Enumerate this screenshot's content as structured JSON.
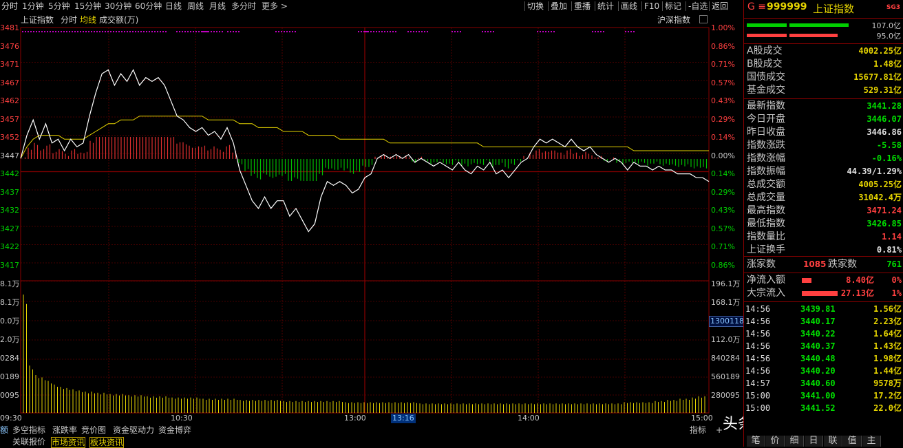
{
  "toolbar": {
    "periods": [
      "分时",
      "1分钟",
      "5分钟",
      "15分钟",
      "30分钟",
      "60分钟",
      "日线",
      "周线",
      "月线",
      "多分时",
      "更多 >"
    ],
    "tools": [
      "切换",
      "叠加",
      "重播",
      "统计",
      "画线",
      "F10",
      "标记",
      "-自选",
      "返回"
    ]
  },
  "chart_header": {
    "name": "上证指数",
    "mode": "分时",
    "avg": "均线",
    "vol_label": "成交额(万)",
    "market": "沪深指数"
  },
  "price_axis": [
    "3481",
    "3476",
    "3471",
    "3467",
    "3462",
    "3457",
    "3452",
    "3447",
    "3442",
    "3437",
    "3432",
    "3427",
    "3422",
    "3417"
  ],
  "pct_axis": [
    "1.00%",
    "0.86%",
    "0.71%",
    "0.57%",
    "0.43%",
    "0.29%",
    "0.14%",
    "0.00%",
    "0.14%",
    "0.29%",
    "0.43%",
    "0.57%",
    "0.71%",
    "0.86%"
  ],
  "vol_axis_left": [
    "8.1万",
    "8.1万",
    "0.0万",
    "2.0万",
    "0284",
    "0189",
    "0095"
  ],
  "vol_axis_right": [
    "196.1万",
    "168.1万",
    "1300118",
    "112.0万",
    "840284",
    "560189",
    "280095"
  ],
  "time_axis": [
    "09:30",
    "10:30",
    "13:00",
    "13:16",
    "14:00",
    "15:00"
  ],
  "chart_data": {
    "type": "line",
    "title": "上证指数 分时",
    "prev_close": 3446.86,
    "ylim": [
      3417,
      3481
    ],
    "x_label": "time",
    "series": [
      {
        "name": "指数",
        "color": "#ffffff",
        "values": [
          3447,
          3453,
          3457,
          3452,
          3456,
          3451,
          3452,
          3449,
          3452,
          3450,
          3451,
          3458,
          3464,
          3469,
          3470,
          3466,
          3469,
          3467,
          3470,
          3466,
          3468,
          3467,
          3468,
          3466,
          3462,
          3458,
          3457,
          3455,
          3454,
          3455,
          3453,
          3454,
          3452,
          3455,
          3451,
          3444,
          3440,
          3436,
          3434,
          3437,
          3434,
          3436,
          3436,
          3432,
          3434,
          3431,
          3428,
          3430,
          3437,
          3441,
          3440,
          3441,
          3440,
          3438,
          3439,
          3442,
          3443,
          3447,
          3448,
          3447,
          3448,
          3447,
          3448,
          3446,
          3447,
          3446,
          3445,
          3446,
          3445,
          3444,
          3446,
          3444,
          3443,
          3445,
          3444,
          3446,
          3443,
          3444,
          3442,
          3444,
          3446,
          3447,
          3450,
          3452,
          3451,
          3452,
          3451,
          3450,
          3452,
          3450,
          3449,
          3450,
          3448,
          3447,
          3446,
          3447,
          3446,
          3444,
          3446,
          3445,
          3445,
          3444,
          3445,
          3444,
          3444,
          3443,
          3443,
          3443,
          3442,
          3442,
          3441
        ]
      },
      {
        "name": "均线",
        "color": "#e6d400",
        "values": [
          3447,
          3450,
          3452,
          3453,
          3453,
          3453,
          3453,
          3452,
          3452,
          3452,
          3452,
          3453,
          3454,
          3455,
          3456,
          3456,
          3457,
          3457,
          3457,
          3458,
          3458,
          3458,
          3458,
          3458,
          3458,
          3458,
          3458,
          3458,
          3458,
          3458,
          3457,
          3457,
          3457,
          3457,
          3457,
          3456,
          3456,
          3456,
          3455,
          3455,
          3455,
          3455,
          3454,
          3454,
          3454,
          3454,
          3453,
          3453,
          3453,
          3453,
          3453,
          3452,
          3452,
          3452,
          3452,
          3452,
          3452,
          3452,
          3452,
          3451,
          3451,
          3451,
          3451,
          3451,
          3451,
          3451,
          3451,
          3451,
          3451,
          3451,
          3451,
          3451,
          3451,
          3451,
          3450,
          3450,
          3450,
          3450,
          3450,
          3450,
          3450,
          3450,
          3450,
          3450,
          3450,
          3450,
          3450,
          3450,
          3450,
          3450,
          3450,
          3450,
          3450,
          3450,
          3450,
          3450,
          3450,
          3450,
          3449,
          3449,
          3449,
          3449,
          3449,
          3449,
          3449,
          3449,
          3449,
          3449,
          3449,
          3449,
          3449
        ]
      }
    ],
    "volume": [
      100,
      40,
      32,
      30,
      27,
      24,
      22,
      21,
      20,
      19,
      18,
      18,
      17,
      17,
      16,
      16,
      16,
      15,
      15,
      15,
      14,
      14,
      14,
      14,
      13,
      13,
      13,
      13,
      13,
      12,
      12,
      12,
      12,
      12,
      12,
      11,
      11,
      11,
      11,
      11,
      11,
      11,
      10,
      10,
      10,
      10,
      10,
      10,
      10,
      10,
      10,
      10,
      9,
      9,
      9,
      9,
      9,
      9,
      9,
      9,
      9,
      9,
      9,
      9,
      8,
      8,
      8,
      8,
      8,
      8,
      8,
      8,
      8,
      8,
      8,
      8,
      8,
      8,
      8,
      8,
      8,
      8,
      8,
      8,
      8,
      8,
      8,
      8,
      8,
      8,
      8,
      8,
      8,
      8,
      8,
      8,
      8,
      9,
      9,
      9,
      9,
      9,
      10,
      10,
      11,
      11,
      12,
      12,
      13,
      14,
      14
    ]
  },
  "right_panel": {
    "code_prefix": "G ≡",
    "code": "999999",
    "name": "上证指数",
    "badge": "SG3",
    "bar1": "107.0亿",
    "bar2": "95.0亿",
    "turnover": [
      {
        "k": "A股成交",
        "v": "4002.25亿"
      },
      {
        "k": "B股成交",
        "v": "1.48亿"
      },
      {
        "k": "国债成交",
        "v": "15677.81亿"
      },
      {
        "k": "基金成交",
        "v": "529.31亿"
      }
    ],
    "stats": [
      {
        "k": "最新指数",
        "v": "3441.28",
        "c": "#00e000"
      },
      {
        "k": "今日开盘",
        "v": "3446.07",
        "c": "#00e000"
      },
      {
        "k": "昨日收盘",
        "v": "3446.86",
        "c": "#e0e0e0"
      },
      {
        "k": "指数涨跌",
        "v": "-5.58",
        "c": "#00e000"
      },
      {
        "k": "指数涨幅",
        "v": "-0.16%",
        "c": "#00e000"
      },
      {
        "k": "指数振幅",
        "v": "44.39/1.29%",
        "c": "#e0e0e0"
      },
      {
        "k": "总成交额",
        "v": "4005.25亿",
        "c": "#e6d400"
      },
      {
        "k": "总成交量",
        "v": "31042.4万",
        "c": "#e6d400"
      },
      {
        "k": "最高指数",
        "v": "3471.24",
        "c": "#ff4040"
      },
      {
        "k": "最低指数",
        "v": "3426.85",
        "c": "#00e000"
      },
      {
        "k": "指数量比",
        "v": "1.14",
        "c": "#ff4040"
      },
      {
        "k": "上证换手",
        "v": "0.81%",
        "c": "#e0e0e0"
      }
    ],
    "up_label": "涨家数",
    "up_count": "1085",
    "down_label": "跌家数",
    "down_count": "761",
    "flows": [
      {
        "k": "净流入额",
        "v": "8.40亿",
        "p": "0%"
      },
      {
        "k": "大宗流入",
        "v": "27.13亿",
        "p": "1%"
      }
    ],
    "ticks": [
      {
        "t": "14:56",
        "p": "3439.81",
        "a": "1.56亿"
      },
      {
        "t": "14:56",
        "p": "3440.17",
        "a": "2.23亿"
      },
      {
        "t": "14:56",
        "p": "3440.22",
        "a": "1.64亿"
      },
      {
        "t": "14:56",
        "p": "3440.37",
        "a": "1.43亿"
      },
      {
        "t": "14:56",
        "p": "3440.48",
        "a": "1.98亿"
      },
      {
        "t": "14:56",
        "p": "3440.20",
        "a": "1.44亿"
      },
      {
        "t": "14:57",
        "p": "3440.60",
        "a": "9578万"
      },
      {
        "t": "15:00",
        "p": "3441.00",
        "a": "17.2亿"
      },
      {
        "t": "15:00",
        "p": "3441.52",
        "a": "22.0亿"
      }
    ],
    "tabs": [
      "笔",
      "价",
      "细",
      "日",
      "联",
      "值",
      "主"
    ]
  },
  "bottom_tabs": [
    "额",
    "多空指标",
    "涨跌率",
    "竞价图",
    "资金驱动力",
    "资金博弈"
  ],
  "bottom_tabs2": [
    "关联报价",
    "市场资讯",
    "板块资讯"
  ],
  "bottom_right": [
    "指标",
    "+"
  ],
  "watermark": "头条 @莱月论股"
}
